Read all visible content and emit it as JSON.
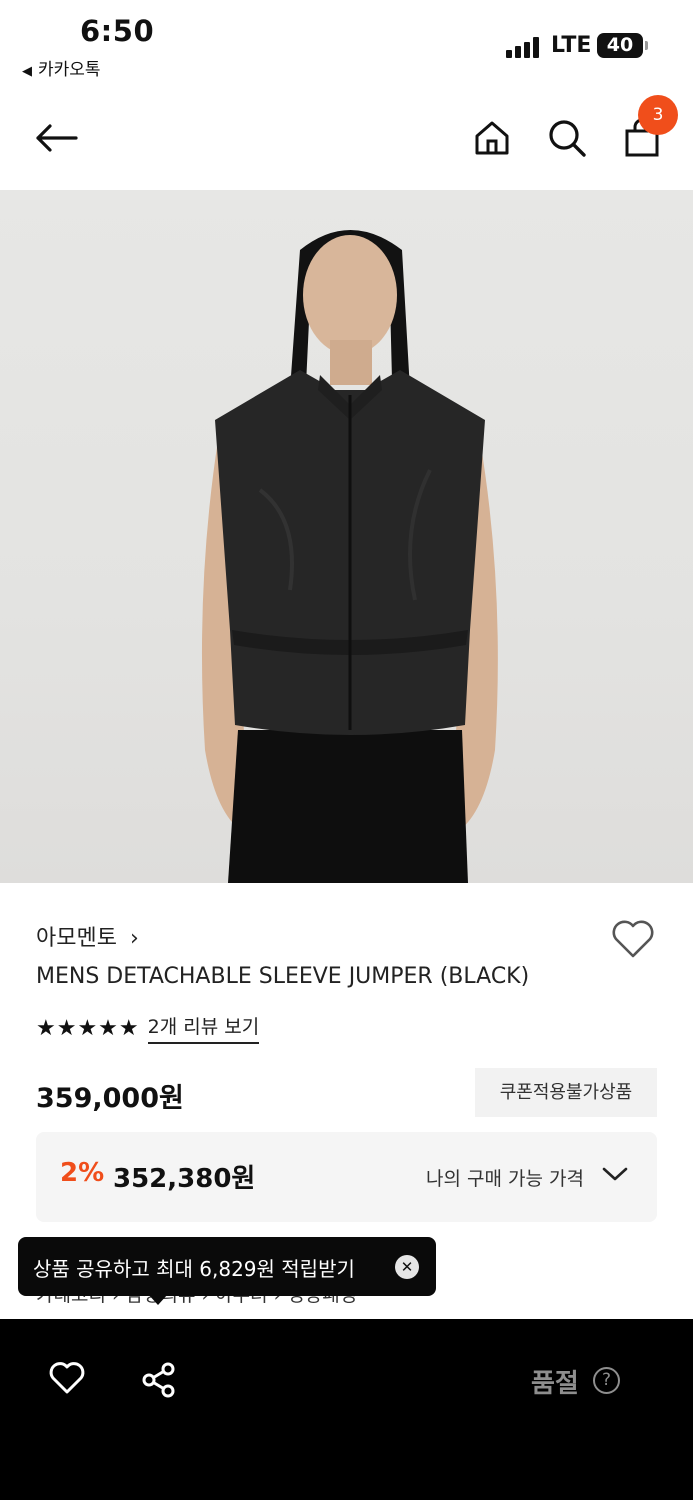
{
  "status_bar": {
    "time": "6:50",
    "back_app": "카카오톡",
    "network": "LTE",
    "battery": "40"
  },
  "nav": {
    "cart_count": "3"
  },
  "product": {
    "brand": "아모멘토",
    "brand_chevron": "›",
    "name": "MENS DETACHABLE SLEEVE JUMPER (BLACK)",
    "stars": "★★★★★",
    "rating": 5,
    "review_link": "2개 리뷰 보기",
    "price": "359,000원",
    "coupon_badge": "쿠폰적용불가상품",
    "discount_rate": "2%",
    "my_price": "352,380원",
    "my_price_label": "나의 구매 가능 가격"
  },
  "breadcrumb": "카테고리 › 남성의류 › 아우터 › 경량패딩",
  "tooltip": {
    "text": "상품 공유하고 최대 6,829원 적립받기",
    "close": "✕"
  },
  "bottom_bar": {
    "soldout_label": "품절",
    "help_label": "?"
  },
  "colors": {
    "accent": "#f04e1b",
    "bottom_bar": "#000000",
    "price_box": "#f5f5f5"
  },
  "icons": [
    "back-arrow-icon",
    "home-icon",
    "search-icon",
    "shopping-bag-icon",
    "heart-icon",
    "share-icon",
    "chevron-down-icon",
    "close-icon",
    "help-icon"
  ]
}
